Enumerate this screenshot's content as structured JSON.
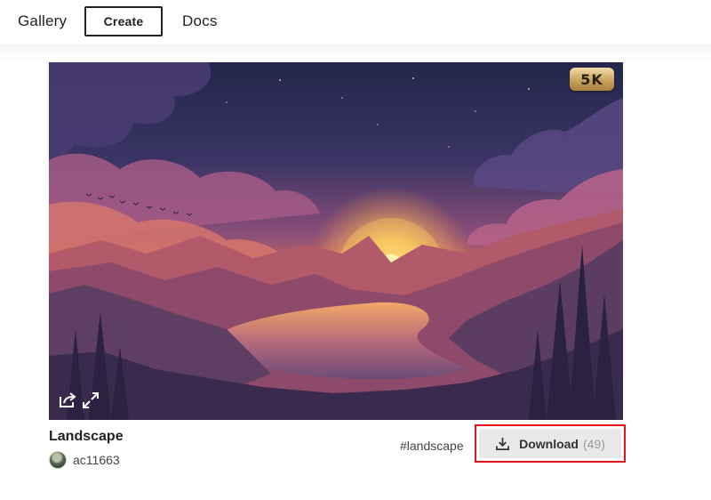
{
  "nav": {
    "items": [
      {
        "label": "Gallery"
      },
      {
        "label": "Create"
      },
      {
        "label": "Docs"
      }
    ]
  },
  "image": {
    "badge": "5K",
    "icons": [
      "share-icon",
      "expand-icon"
    ]
  },
  "meta": {
    "title": "Landscape",
    "author": "ac11663",
    "tag": "#landscape"
  },
  "download": {
    "label": "Download",
    "count": "(49)",
    "icon": "download-icon",
    "highlight_color": "#e0141b"
  }
}
